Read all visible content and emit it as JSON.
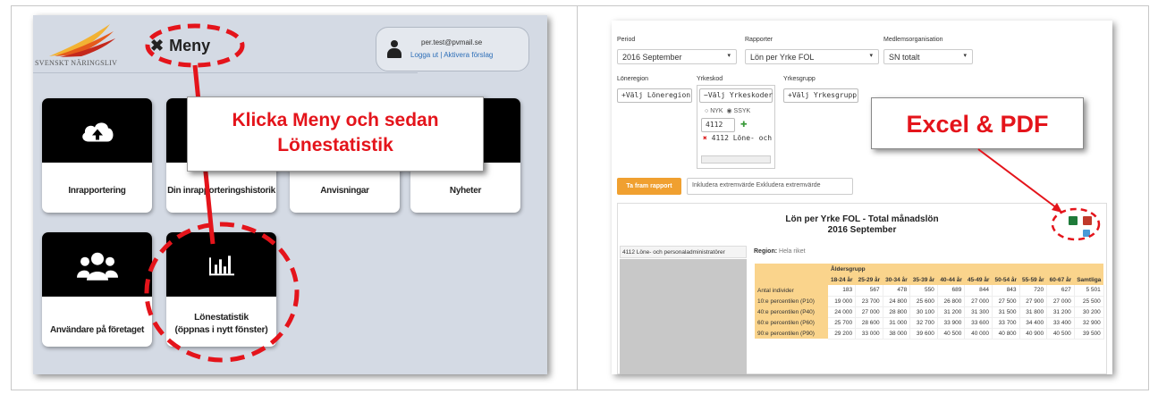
{
  "left": {
    "logo_text": "SVENSKT NÄRINGSLIV",
    "menu_label": "Meny",
    "user_email": "per.test@pvmail.se",
    "user_links": "Logga ut | Aktivera förslag",
    "tiles": [
      {
        "label": "Inrapportering",
        "icon": "cloud-upload-icon"
      },
      {
        "label": "Din inrapporteringshistorik",
        "icon": "history-icon"
      },
      {
        "label": "Anvisningar",
        "icon": "info-icon"
      },
      {
        "label": "Nyheter",
        "icon": "news-icon"
      },
      {
        "label": "Användare på företaget",
        "icon": "users-icon"
      },
      {
        "label_line1": "Lönestatistik",
        "label_line2": "(öppnas i nytt fönster)",
        "icon": "bar-chart-icon"
      }
    ],
    "callout_line1": "Klicka Meny och sedan",
    "callout_line2": "Lönestatistik"
  },
  "right": {
    "period_label": "Period",
    "period_value": "2016 September",
    "rapporter_label": "Rapporter",
    "rapporter_value": "Lön per Yrke FOL",
    "medlem_label": "Medlemsorganisation",
    "medlem_value": "SN totalt",
    "loneregion_label": "Löneregion",
    "loneregion_btn": "Välj Löneregion",
    "yrkeskod_label": "Yrkeskod",
    "yrkeskod_btn": "Välj Yrkeskoder",
    "yrkesgrupp_label": "Yrkesgrupp",
    "yrkesgrupp_btn": "Välj Yrkesgrupp",
    "nyk": "NYK",
    "ssyk": "SSYK",
    "code_input": "4112",
    "selected_code": "4112 Löne- och",
    "callout": "Excel & PDF",
    "run_btn": "Ta fram rapport",
    "radio_text": "Inkludera extremvärde   Exkludera extremvärde",
    "report_title1": "Lön per Yrke FOL - Total månadslön",
    "report_title2": "2016 September",
    "side_item": "4112 Löne- och personaladministratörer",
    "region_label": "Region:",
    "region_value": "Hela riket",
    "age_group_label": "Åldersgrupp",
    "age_groups": [
      "18-24 år",
      "25-29 år",
      "30-34 år",
      "35-39 år",
      "40-44 år",
      "45-49 år",
      "50-54 år",
      "55-59 år",
      "60-67 år",
      "Samtliga"
    ],
    "rows": [
      {
        "label": "Antal individer",
        "values": [
          "183",
          "567",
          "478",
          "550",
          "689",
          "844",
          "843",
          "720",
          "627",
          "5 501"
        ]
      },
      {
        "label": "10:e percentilen (P10)",
        "values": [
          "19 000",
          "23 700",
          "24 800",
          "25 600",
          "26 800",
          "27 000",
          "27 500",
          "27 900",
          "27 000",
          "25 500"
        ]
      },
      {
        "label": "40:e percentilen (P40)",
        "values": [
          "24 000",
          "27 000",
          "28 800",
          "30 100",
          "31 200",
          "31 300",
          "31 500",
          "31 800",
          "31 200",
          "30 200"
        ]
      },
      {
        "label": "60:e percentilen (P60)",
        "values": [
          "25 700",
          "28 600",
          "31 000",
          "32 700",
          "33 900",
          "33 600",
          "33 700",
          "34 400",
          "33 400",
          "32 900"
        ]
      },
      {
        "label": "90:e percentilen (P90)",
        "values": [
          "29 200",
          "33 000",
          "38 000",
          "39 600",
          "40 500",
          "40 000",
          "40 800",
          "40 900",
          "40 500",
          "39 500"
        ]
      }
    ]
  }
}
